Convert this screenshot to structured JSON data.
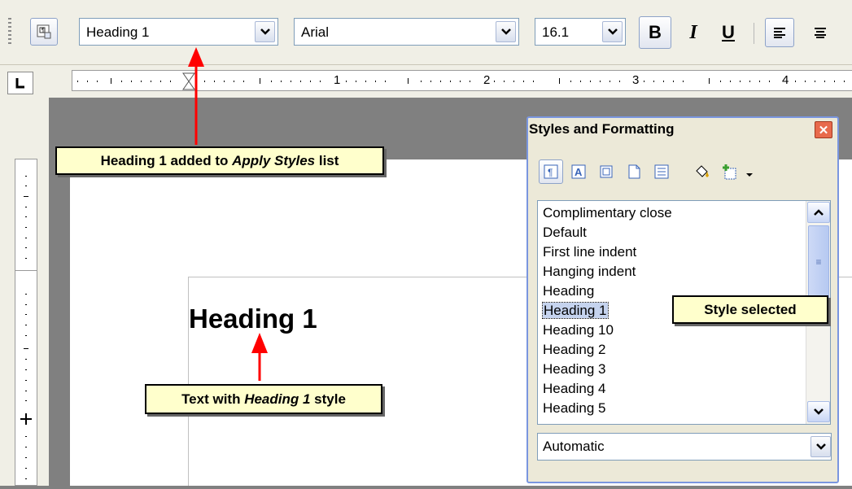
{
  "toolbar": {
    "apply_style": "Heading 1",
    "font_name": "Arial",
    "font_size": "16.1",
    "bold_label": "B",
    "italic_label": "I",
    "underline_label": "U"
  },
  "ruler": {
    "numbers": [
      "1",
      "2",
      "3",
      "4"
    ]
  },
  "document": {
    "heading_text": "Heading 1"
  },
  "callouts": {
    "apply_styles": {
      "bold_1": "Heading",
      "bold_2": " 1",
      "plain": " added to ",
      "italic": "Apply Styles",
      "tail": " list"
    },
    "text_with": {
      "pre": "Text with ",
      "italic": "Heading 1",
      "post": " style"
    },
    "style_selected": "Style selected"
  },
  "styles_panel": {
    "title": "Styles and Formatting",
    "items": [
      "Complimentary close",
      "Default",
      "First line indent",
      "Hanging indent",
      "Heading",
      "Heading 1",
      "Heading 10",
      "Heading 2",
      "Heading 3",
      "Heading 4",
      "Heading 5"
    ],
    "selected": "Heading 1",
    "filter": "Automatic"
  },
  "colors": {
    "callout_bg": "#ffffcc",
    "arrow": "#ff0000",
    "panel_border": "#7a96df"
  }
}
